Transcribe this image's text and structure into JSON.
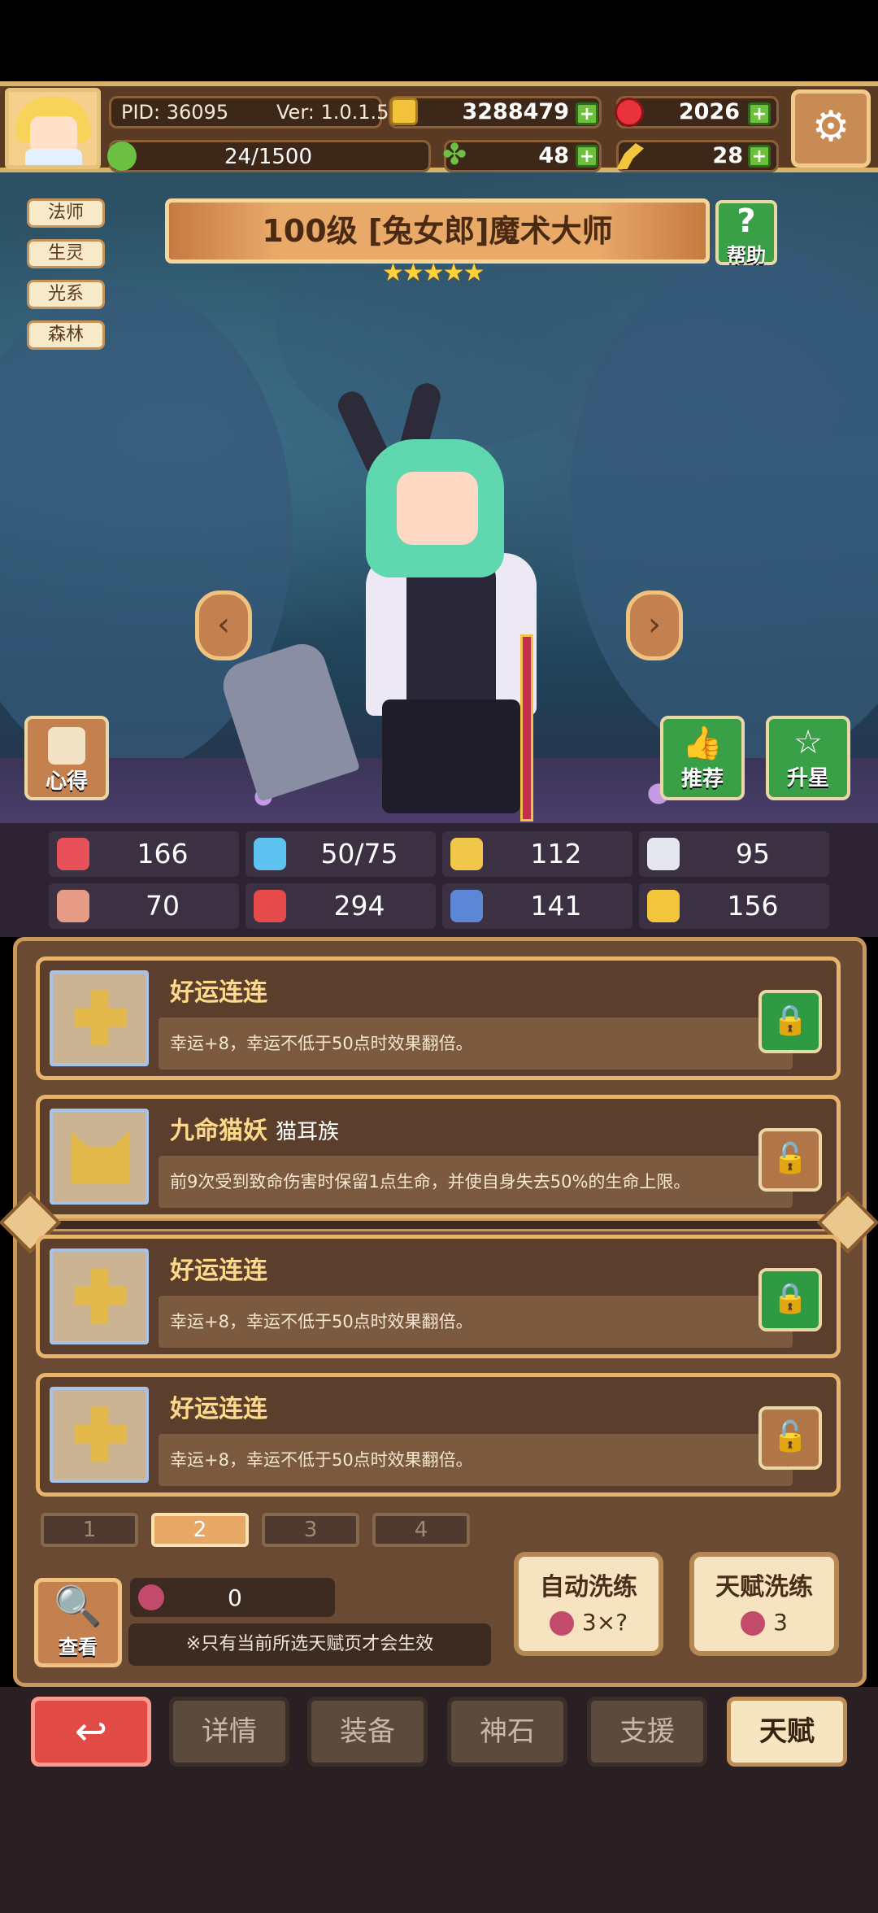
{
  "header": {
    "pid": "PID: 36095",
    "version": "Ver: 1.0.1.5",
    "gold": "3288479",
    "gems": "2026",
    "stamina": "24/1500",
    "clover": "48",
    "horn": "28"
  },
  "hero": {
    "tags": [
      "法师",
      "生灵",
      "光系",
      "森林"
    ],
    "title": "100级 [兔女郎]魔术大师",
    "stars": "★★★★★",
    "help_label": "帮助",
    "insight_label": "心得",
    "recommend_label": "推荐",
    "star_up_label": "升星"
  },
  "stats": [
    {
      "icon": "heart-icon",
      "value": "166",
      "color": "#e8515a"
    },
    {
      "icon": "water-drop-icon",
      "value": "50/75",
      "color": "#5ec3ee"
    },
    {
      "icon": "shield-icon",
      "value": "112",
      "color": "#f1c74a"
    },
    {
      "icon": "wing-icon",
      "value": "95",
      "color": "#e6e6ee"
    },
    {
      "icon": "fist-icon",
      "value": "70",
      "color": "#e59b86"
    },
    {
      "icon": "book-icon",
      "value": "294",
      "color": "#e74a4a"
    },
    {
      "icon": "scroll-icon",
      "value": "141",
      "color": "#5c86d6"
    },
    {
      "icon": "horseshoe-icon",
      "value": "156",
      "color": "#f3c53c"
    }
  ],
  "talents": [
    {
      "name": "好运连连",
      "tribe": "",
      "desc": "幸运+8，幸运不低于50点时效果翻倍。",
      "locked": "green"
    },
    {
      "name": "九命猫妖",
      "tribe": "猫耳族",
      "desc": "前9次受到致命伤害时保留1点生命，并使自身失去50%的生命上限。",
      "locked": "brown"
    },
    {
      "name": "好运连连",
      "tribe": "",
      "desc": "幸运+8，幸运不低于50点时效果翻倍。",
      "locked": "green"
    },
    {
      "name": "好运连连",
      "tribe": "",
      "desc": "幸运+8，幸运不低于50点时效果翻倍。",
      "locked": "brown"
    }
  ],
  "pages": [
    "1",
    "2",
    "3",
    "4"
  ],
  "active_page": "2",
  "controls": {
    "view_label": "查看",
    "resource_count": "0",
    "notice": "※只有当前所选天赋页才会生效",
    "auto_wash_label": "自动洗练",
    "auto_wash_cost": "3×?",
    "talent_wash_label": "天赋洗练",
    "talent_wash_cost": "3"
  },
  "nav": {
    "back": "↩",
    "details": "详情",
    "equipment": "装备",
    "godstone": "神石",
    "support": "支援",
    "talent": "天赋"
  }
}
